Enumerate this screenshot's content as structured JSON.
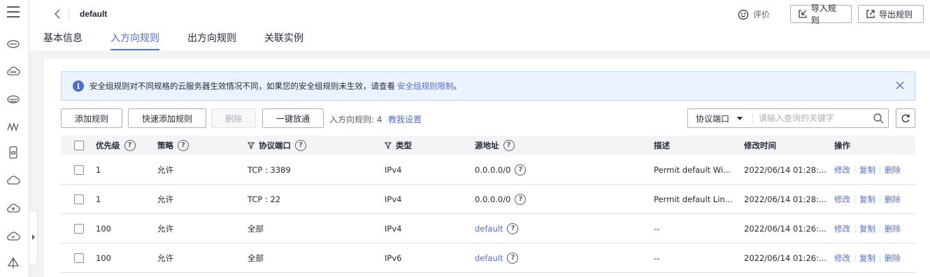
{
  "header": {
    "title": "default",
    "rate_label": "评价",
    "import_label": "导入规则",
    "export_label": "导出规则"
  },
  "tabs": [
    {
      "label": "基本信息",
      "active": false
    },
    {
      "label": "入方向规则",
      "active": true
    },
    {
      "label": "出方向规则",
      "active": false
    },
    {
      "label": "关联实例",
      "active": false
    }
  ],
  "notice": {
    "text": "安全组规则对不同规格的云服务器生效情况不同，如果您的安全组规则未生效，请查看",
    "link": "安全组规则限制",
    "tail": "。"
  },
  "toolbar": {
    "add": "添加规则",
    "quick_add": "快速添加规则",
    "delete": "删除",
    "one_click": "一键放通",
    "count_label": "入方向规则: 4",
    "help": "教我设置",
    "filter_select": "协议端口",
    "filter_placeholder": "请输入查询的关键字"
  },
  "table": {
    "columns": {
      "priority": "优先级",
      "action": "策略",
      "protocol": "协议端口",
      "type": "类型",
      "source": "源地址",
      "description": "描述",
      "modified": "修改时间",
      "operations": "操作"
    },
    "rows": [
      {
        "priority": "1",
        "action": "允许",
        "protocol": "TCP : 3389",
        "type": "IPv4",
        "source": "0.0.0.0/0",
        "description": "Permit default Wi...",
        "modified": "2022/06/14 01:28:...",
        "op_modify": "修改",
        "op_copy": "复制",
        "op_delete": "删除"
      },
      {
        "priority": "1",
        "action": "允许",
        "protocol": "TCP : 22",
        "type": "IPv4",
        "source": "0.0.0.0/0",
        "description": "Permit default Lin...",
        "modified": "2022/06/14 01:28:...",
        "op_modify": "修改",
        "op_copy": "复制",
        "op_delete": "删除"
      },
      {
        "priority": "100",
        "action": "允许",
        "protocol": "全部",
        "type": "IPv4",
        "source": "default",
        "description": "--",
        "modified": "2022/06/14 01:26:...",
        "op_modify": "修改",
        "op_copy": "复制",
        "op_delete": "删除"
      },
      {
        "priority": "100",
        "action": "允许",
        "protocol": "全部",
        "type": "IPv6",
        "source": "default",
        "description": "--",
        "modified": "2022/06/14 01:26:...",
        "op_modify": "修改",
        "op_copy": "复制",
        "op_delete": "删除"
      }
    ]
  },
  "colors": {
    "accent": "#526ecc",
    "notice_bg": "#eaf3fe",
    "border": "#adb0b8"
  }
}
